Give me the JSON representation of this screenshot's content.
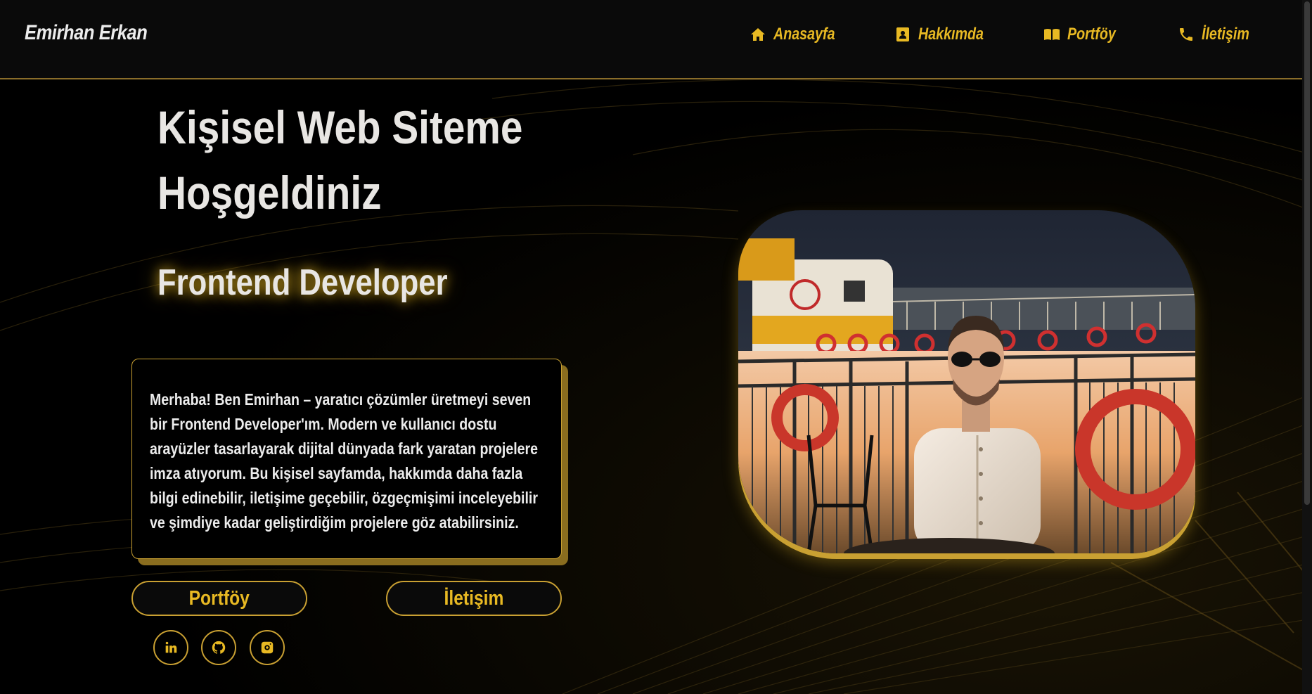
{
  "header": {
    "brand": "Emirhan Erkan",
    "nav": [
      {
        "label": "Anasayfa",
        "icon": "home-icon"
      },
      {
        "label": "Hakkımda",
        "icon": "contact-card-icon"
      },
      {
        "label": "Portföy",
        "icon": "book-open-icon"
      },
      {
        "label": "İletişim",
        "icon": "phone-icon"
      }
    ]
  },
  "hero": {
    "title_line1": "Kişisel Web Siteme",
    "title_line2": "Hoşgeldiniz",
    "subtitle": "Frontend Developer",
    "bio": "Merhaba! Ben Emirhan – yaratıcı çözümler üretmeyi seven bir Frontend Developer'ım. Modern ve kullanıcı dostu arayüzler tasarlayarak dijital dünyada fark yaratan projelere imza atıyorum. Bu kişisel sayfamda, hakkımda daha fazla bilgi edinebilir, iletişime geçebilir, özgeçmişimi inceleyebilir ve şimdiye kadar geliştirdiğim projelere göz atabilirsiniz."
  },
  "buttons": {
    "portfolio": "Portföy",
    "contact": "İletişim"
  },
  "social": [
    {
      "icon": "linkedin-icon"
    },
    {
      "icon": "github-icon"
    },
    {
      "icon": "instagram-icon"
    }
  ],
  "colors": {
    "accent": "#e8b923",
    "border": "#c9a032",
    "background": "#000000",
    "text": "#e8e6e3"
  }
}
